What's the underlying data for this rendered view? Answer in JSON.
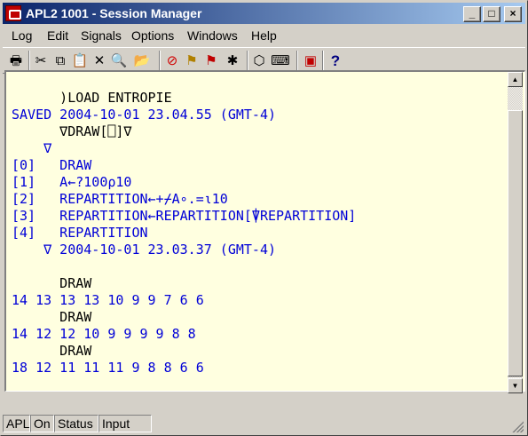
{
  "window": {
    "title": "APL2 1001 - Session Manager",
    "title_icon": "apl2-app-icon",
    "buttons": {
      "minimize": "_",
      "maximize": "□",
      "close": "×"
    }
  },
  "menu": [
    "Log",
    "Edit",
    "Signals",
    "Options",
    "Windows",
    "Help"
  ],
  "toolbar": [
    {
      "name": "print-icon",
      "glyph": "🖶",
      "color": "#000000"
    },
    {
      "name": "cut-icon",
      "glyph": "✂",
      "color": "#000000"
    },
    {
      "name": "copy-icon",
      "glyph": "⧉",
      "color": "#000000"
    },
    {
      "name": "paste-icon",
      "glyph": "📋",
      "color": "#000000"
    },
    {
      "name": "delete-icon",
      "glyph": "✕",
      "color": "#000000"
    },
    {
      "name": "find-icon",
      "glyph": "🔍",
      "color": "#000000"
    },
    {
      "name": "open-folder-icon",
      "glyph": "📂",
      "color": "#b08000"
    },
    {
      "name": "stop-icon",
      "glyph": "⊘",
      "color": "#d00000"
    },
    {
      "name": "signal-flag-icon",
      "glyph": "⚑",
      "color": "#b08000"
    },
    {
      "name": "interrupt-icon",
      "glyph": "⚑",
      "color": "#c00000"
    },
    {
      "name": "tools-icon",
      "glyph": "✱",
      "color": "#000000"
    },
    {
      "name": "object-editor-icon",
      "glyph": "⬡",
      "color": "#000000"
    },
    {
      "name": "keyboard-icon",
      "glyph": "⌨",
      "color": "#000000"
    },
    {
      "name": "apl-session-icon",
      "glyph": "▣",
      "color": "#c00000"
    },
    {
      "name": "help-icon",
      "glyph": "?",
      "color": "#000080"
    }
  ],
  "session": {
    "lines": [
      {
        "text": "      )LOAD ENTROPIE",
        "kind": "input"
      },
      {
        "text": "SAVED 2004-10-01 23.04.55 (GMT-4)",
        "kind": "output"
      },
      {
        "text": "      ∇DRAW[⎕]∇",
        "kind": "input"
      },
      {
        "text": "    ∇",
        "kind": "output"
      },
      {
        "text": "[0]   DRAW",
        "kind": "output"
      },
      {
        "text": "[1]   A←?100⍴10",
        "kind": "output"
      },
      {
        "text": "[2]   REPARTITION←+⌿A∘.=⍳10",
        "kind": "output"
      },
      {
        "text": "[3]   REPARTITION←REPARTITION[⍒REPARTITION]",
        "kind": "output"
      },
      {
        "text": "[4]   REPARTITION",
        "kind": "output"
      },
      {
        "text": "    ∇ 2004-10-01 23.03.37 (GMT-4)",
        "kind": "output"
      },
      {
        "text": "",
        "kind": "input"
      },
      {
        "text": "      DRAW",
        "kind": "input"
      },
      {
        "text": "14 13 13 13 10 9 9 7 6 6",
        "kind": "output"
      },
      {
        "text": "      DRAW",
        "kind": "input"
      },
      {
        "text": "14 12 12 10 9 9 9 9 8 8",
        "kind": "output"
      },
      {
        "text": "      DRAW",
        "kind": "input"
      },
      {
        "text": "18 12 11 11 11 9 8 8 6 6",
        "kind": "output"
      }
    ],
    "colors": {
      "background": "#ffffe0",
      "input": "#000000",
      "output": "#0000d8"
    },
    "scrollbar": {
      "position": 0.92
    }
  },
  "status": [
    "APL",
    "On",
    "Status",
    "Input"
  ]
}
